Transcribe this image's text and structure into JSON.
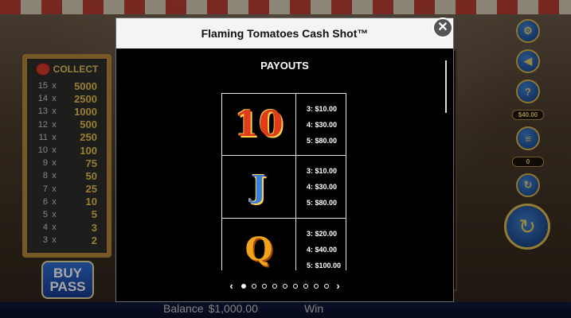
{
  "game": {
    "paytable_header": "COLLECT",
    "paytable": [
      {
        "count": "15",
        "x": "x",
        "prize": "5000"
      },
      {
        "count": "14",
        "x": "x",
        "prize": "2500"
      },
      {
        "count": "13",
        "x": "x",
        "prize": "1000"
      },
      {
        "count": "12",
        "x": "x",
        "prize": "500"
      },
      {
        "count": "11",
        "x": "x",
        "prize": "250"
      },
      {
        "count": "10",
        "x": "x",
        "prize": "100"
      },
      {
        "count": "9",
        "x": "x",
        "prize": "75"
      },
      {
        "count": "8",
        "x": "x",
        "prize": "50"
      },
      {
        "count": "7",
        "x": "x",
        "prize": "25"
      },
      {
        "count": "6",
        "x": "x",
        "prize": "10"
      },
      {
        "count": "5",
        "x": "x",
        "prize": "5"
      },
      {
        "count": "4",
        "x": "x",
        "prize": "3"
      },
      {
        "count": "3",
        "x": "x",
        "prize": "2"
      }
    ],
    "buy_pass": [
      "BUY",
      "PASS"
    ],
    "bet_value": "$40.00",
    "counter_value": "0",
    "balance_label": "Balance",
    "balance_value": "$1,000.00",
    "win_label": "Win"
  },
  "modal": {
    "title": "Flaming Tomatoes Cash Shot™",
    "close_glyph": "✕",
    "section_title": "PAYOUTS",
    "rows": [
      {
        "symbol": "10",
        "payouts": [
          "3: $10.00",
          "4: $30.00",
          "5: $80.00"
        ]
      },
      {
        "symbol": "J",
        "payouts": [
          "3: $10.00",
          "4: $30.00",
          "5: $80.00"
        ]
      },
      {
        "symbol": "Q",
        "payouts": [
          "3: $20.00",
          "4: $40.00",
          "5: $100.00"
        ]
      }
    ],
    "pager": {
      "prev": "‹",
      "next": "›",
      "dots": 9,
      "active": 0
    }
  },
  "icons": {
    "settings": "gear-icon",
    "sound": "speaker-icon",
    "help": "question-icon",
    "coins": "coin-stack-icon",
    "autoplay": "refresh-icon",
    "spin": "spin-arrow-icon"
  }
}
